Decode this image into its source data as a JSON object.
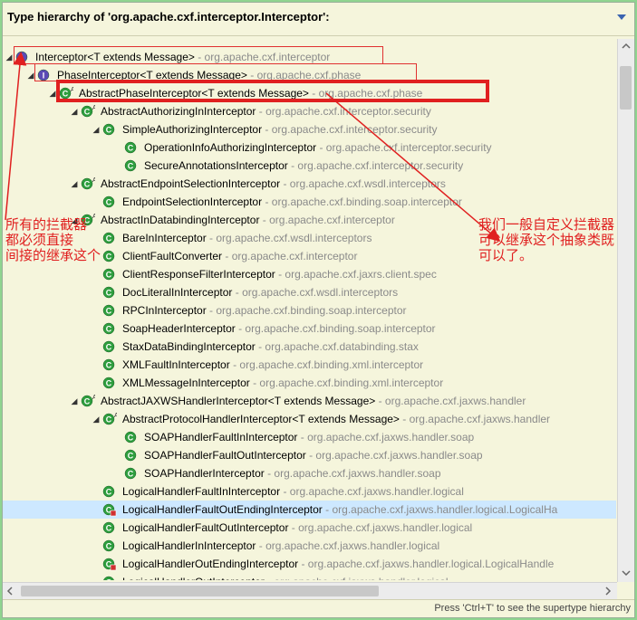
{
  "title": "Type hierarchy of 'org.apache.cxf.interceptor.Interceptor':",
  "status_hint": "Press 'Ctrl+T' to see the supertype hierarchy",
  "colors": {
    "annotation": "#e02020",
    "package": "#8a8a8a",
    "class_icon": "#2e9e3e",
    "interface_icon": "#5b4bb5"
  },
  "annotations": {
    "left_note": [
      "所有的拦截器",
      "都必须直接",
      "间接的继承这个"
    ],
    "right_note": [
      "我们一般自定义拦截器",
      "可以继承这个抽象类既",
      "可以了。"
    ]
  },
  "tree": [
    {
      "level": 0,
      "expanded": true,
      "kind": "interface",
      "modifier": "",
      "name": "Interceptor<T extends Message>",
      "pkg": " - org.apache.cxf.interceptor"
    },
    {
      "level": 1,
      "expanded": true,
      "kind": "interface",
      "modifier": "",
      "name": "PhaseInterceptor<T extends Message>",
      "pkg": " - org.apache.cxf.phase"
    },
    {
      "level": 2,
      "expanded": true,
      "kind": "class",
      "modifier": "A",
      "name": "AbstractPhaseInterceptor<T extends Message>",
      "pkg": " - org.apache.cxf.phase"
    },
    {
      "level": 3,
      "expanded": true,
      "kind": "class",
      "modifier": "A",
      "name": "AbstractAuthorizingInInterceptor",
      "pkg": " - org.apache.cxf.interceptor.security"
    },
    {
      "level": 4,
      "expanded": true,
      "kind": "class",
      "modifier": "",
      "name": "SimpleAuthorizingInterceptor",
      "pkg": " - org.apache.cxf.interceptor.security"
    },
    {
      "level": 5,
      "expanded": null,
      "kind": "class",
      "modifier": "",
      "name": "OperationInfoAuthorizingInterceptor",
      "pkg": " - org.apache.cxf.interceptor.security"
    },
    {
      "level": 5,
      "expanded": null,
      "kind": "class",
      "modifier": "",
      "name": "SecureAnnotationsInterceptor",
      "pkg": " - org.apache.cxf.interceptor.security"
    },
    {
      "level": 3,
      "expanded": true,
      "kind": "class",
      "modifier": "A",
      "name": "AbstractEndpointSelectionInterceptor",
      "pkg": " - org.apache.cxf.wsdl.interceptors"
    },
    {
      "level": 4,
      "expanded": null,
      "kind": "class",
      "modifier": "",
      "name": "EndpointSelectionInterceptor",
      "pkg": " - org.apache.cxf.binding.soap.interceptor"
    },
    {
      "level": 3,
      "expanded": true,
      "kind": "class",
      "modifier": "A",
      "name": "AbstractInDatabindingInterceptor",
      "pkg": " - org.apache.cxf.interceptor"
    },
    {
      "level": 4,
      "expanded": null,
      "kind": "class",
      "modifier": "",
      "name": "BareInInterceptor",
      "pkg": " - org.apache.cxf.wsdl.interceptors"
    },
    {
      "level": 4,
      "expanded": null,
      "kind": "class",
      "modifier": "",
      "name": "ClientFaultConverter",
      "pkg": " - org.apache.cxf.interceptor"
    },
    {
      "level": 4,
      "expanded": null,
      "kind": "class",
      "modifier": "",
      "name": "ClientResponseFilterInterceptor",
      "pkg": " - org.apache.cxf.jaxrs.client.spec"
    },
    {
      "level": 4,
      "expanded": null,
      "kind": "class",
      "modifier": "",
      "name": "DocLiteralInInterceptor",
      "pkg": " - org.apache.cxf.wsdl.interceptors"
    },
    {
      "level": 4,
      "expanded": null,
      "kind": "class",
      "modifier": "",
      "name": "RPCInInterceptor",
      "pkg": " - org.apache.cxf.binding.soap.interceptor"
    },
    {
      "level": 4,
      "expanded": null,
      "kind": "class",
      "modifier": "",
      "name": "SoapHeaderInterceptor",
      "pkg": " - org.apache.cxf.binding.soap.interceptor"
    },
    {
      "level": 4,
      "expanded": null,
      "kind": "class",
      "modifier": "",
      "name": "StaxDataBindingInterceptor",
      "pkg": " - org.apache.cxf.databinding.stax"
    },
    {
      "level": 4,
      "expanded": null,
      "kind": "class",
      "modifier": "",
      "name": "XMLFaultInInterceptor",
      "pkg": " - org.apache.cxf.binding.xml.interceptor"
    },
    {
      "level": 4,
      "expanded": null,
      "kind": "class",
      "modifier": "",
      "name": "XMLMessageInInterceptor",
      "pkg": " - org.apache.cxf.binding.xml.interceptor"
    },
    {
      "level": 3,
      "expanded": true,
      "kind": "class",
      "modifier": "A",
      "name": "AbstractJAXWSHandlerInterceptor<T extends Message>",
      "pkg": " - org.apache.cxf.jaxws.handler"
    },
    {
      "level": 4,
      "expanded": true,
      "kind": "class",
      "modifier": "A",
      "name": "AbstractProtocolHandlerInterceptor<T extends Message>",
      "pkg": " - org.apache.cxf.jaxws.handler"
    },
    {
      "level": 5,
      "expanded": null,
      "kind": "class",
      "modifier": "",
      "name": "SOAPHandlerFaultInInterceptor",
      "pkg": " - org.apache.cxf.jaxws.handler.soap"
    },
    {
      "level": 5,
      "expanded": null,
      "kind": "class",
      "modifier": "",
      "name": "SOAPHandlerFaultOutInterceptor",
      "pkg": " - org.apache.cxf.jaxws.handler.soap"
    },
    {
      "level": 5,
      "expanded": null,
      "kind": "class",
      "modifier": "",
      "name": "SOAPHandlerInterceptor",
      "pkg": " - org.apache.cxf.jaxws.handler.soap"
    },
    {
      "level": 4,
      "expanded": null,
      "kind": "class",
      "modifier": "",
      "name": "LogicalHandlerFaultInInterceptor",
      "pkg": " - org.apache.cxf.jaxws.handler.logical"
    },
    {
      "level": 4,
      "expanded": null,
      "kind": "class-marked",
      "modifier": "",
      "name": "LogicalHandlerFaultOutEndingInterceptor",
      "pkg": " - org.apache.cxf.jaxws.handler.logical.LogicalHa",
      "selected": true
    },
    {
      "level": 4,
      "expanded": null,
      "kind": "class",
      "modifier": "",
      "name": "LogicalHandlerFaultOutInterceptor",
      "pkg": " - org.apache.cxf.jaxws.handler.logical"
    },
    {
      "level": 4,
      "expanded": null,
      "kind": "class",
      "modifier": "",
      "name": "LogicalHandlerInInterceptor",
      "pkg": " - org.apache.cxf.jaxws.handler.logical"
    },
    {
      "level": 4,
      "expanded": null,
      "kind": "class-marked",
      "modifier": "",
      "name": "LogicalHandlerOutEndingInterceptor",
      "pkg": " - org.apache.cxf.jaxws.handler.logical.LogicalHandle"
    },
    {
      "level": 4,
      "expanded": null,
      "kind": "class",
      "modifier": "",
      "name": "LogicalHandlerOutInterceptor",
      "pkg": " - org.apache.cxf.jaxws.handler.logical"
    }
  ]
}
